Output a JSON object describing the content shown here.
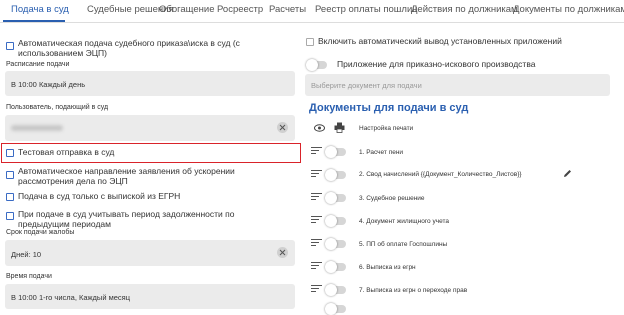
{
  "tabs": [
    {
      "label": "Подача в суд",
      "active": true
    },
    {
      "label": "Судебные решения"
    },
    {
      "label": "Обогащение"
    },
    {
      "label": "Росреестр"
    },
    {
      "label": "Расчеты"
    },
    {
      "label": "Реестр оплаты пошлин"
    },
    {
      "label": "Действия по должникам"
    },
    {
      "label": "Документы по должникам"
    }
  ],
  "left": {
    "auto_submit_label": "Автоматическая подача судебного приказа\\иска в суд (с использованием ЭЦП)",
    "schedule_label": "Расписание подачи",
    "schedule_value": "В 10:00 Каждый день",
    "user_label": "Пользователь, подающий в суд",
    "test_send_label": "Тестовая отправка в суд",
    "auto_accel_label": "Автоматическое направление заявления об ускорении рассмотрения дела по ЭЦП",
    "egrn_only_label": "Подача в суд только с выпиской из ЕГРН",
    "prev_debt_label": "При подаче в суд учитывать период задолженности по предыдущим периодам",
    "complaint_term_label": "Срок подачи жалобы",
    "complaint_term_value": "Дней: 10",
    "submit_time_label": "Время подачи",
    "submit_time_value": "В 10:00 1-го числа, Каждый месяц"
  },
  "right": {
    "auto_attach_label": "Включить автоматический вывод установленных приложений",
    "order_claim_label": "Приложение для приказно-искового производства",
    "order_claim_placeholder": "Выберите документ для подачи",
    "docs_title": "Документы для подачи в суд",
    "print_settings_label": "Настройка печати",
    "docs": [
      {
        "label": "1. Расчет пени"
      },
      {
        "label": "2. Свод начислений {{Документ_Количество_Листов}}"
      },
      {
        "label": "3. Судебное решение"
      },
      {
        "label": "4. Документ жилищного учета"
      },
      {
        "label": "5. ПП об оплате Госпошлины"
      },
      {
        "label": "6. Выписка из егрн"
      },
      {
        "label": "7. Выписка из егрн о переходе прав"
      }
    ]
  },
  "colors": {
    "accent": "#2a5fb0",
    "highlight": "#d9232a",
    "field_bg": "#ebebeb"
  }
}
